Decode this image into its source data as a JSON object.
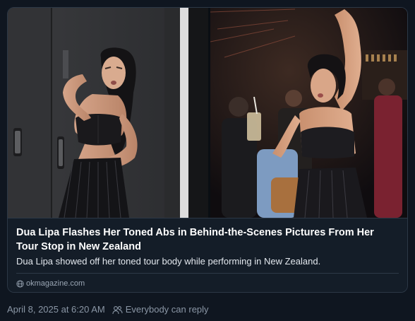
{
  "card": {
    "headline": "Dua Lipa Flashes Her Toned Abs in Behind-the-Scenes Pictures From Her Tour Stop in New Zealand",
    "description": "Dua Lipa showed off her toned tour body while performing in New Zealand.",
    "source": "okmagazine.com",
    "images": [
      {
        "alt": "Dua Lipa posing in a black bralette and pinstripe trousers backstage"
      },
      {
        "alt": "Dua Lipa raising her arm in a crowded nightclub"
      }
    ]
  },
  "post_meta": {
    "timestamp": "April 8, 2025 at 6:20 AM",
    "reply_setting": "Everybody can reply"
  },
  "icons": {
    "source": "globe-icon",
    "audience": "people-icon"
  },
  "colors": {
    "background": "#0f1620",
    "card_background": "#141d28",
    "card_border": "#2c3846",
    "headline": "#ffffff",
    "muted_text": "#8a96a5"
  }
}
